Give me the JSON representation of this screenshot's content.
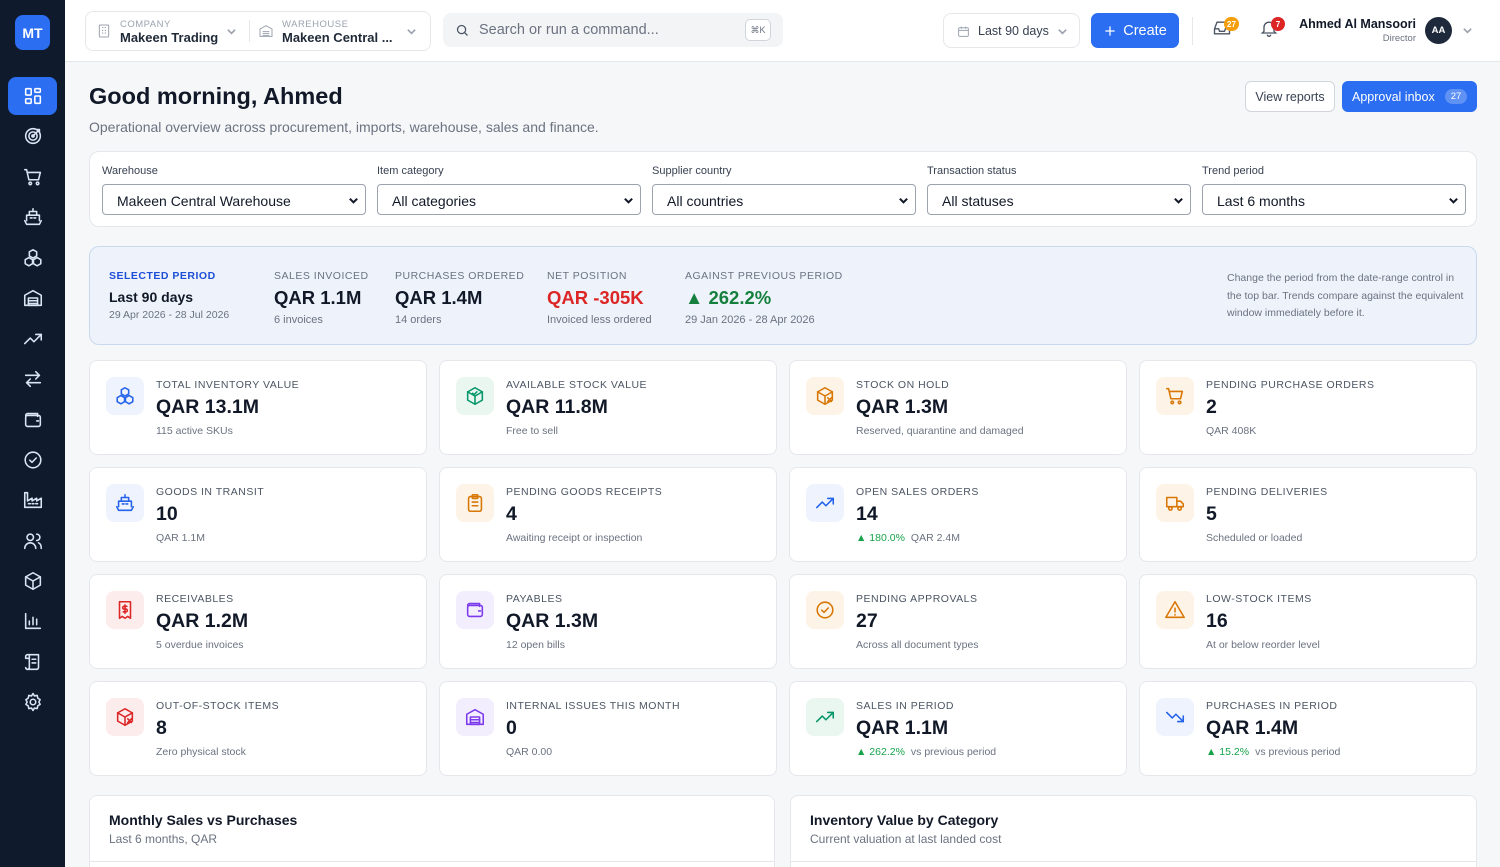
{
  "sidebar": {
    "logo": "MT",
    "items": [
      {
        "icon": "dashboard-icon",
        "active": true
      },
      {
        "icon": "target-icon"
      },
      {
        "icon": "cart-icon"
      },
      {
        "icon": "ship-icon"
      },
      {
        "icon": "boxes-icon"
      },
      {
        "icon": "warehouse-icon"
      },
      {
        "icon": "trending-up-icon"
      },
      {
        "icon": "transfer-icon"
      },
      {
        "icon": "wallet-icon"
      },
      {
        "icon": "check-circle-icon"
      },
      {
        "icon": "factory-icon"
      },
      {
        "icon": "users-icon"
      },
      {
        "icon": "package-icon"
      },
      {
        "icon": "bar-chart-icon"
      },
      {
        "icon": "scroll-icon"
      },
      {
        "icon": "settings-icon"
      }
    ]
  },
  "topbar": {
    "company_label": "COMPANY",
    "company_value": "Makeen Trading",
    "warehouse_label": "WAREHOUSE",
    "warehouse_value": "Makeen Central ...",
    "search_placeholder": "Search or run a command...",
    "search_shortcut": "⌘K",
    "date_range": "Last 90 days",
    "create_label": "Create",
    "inbox_badge": "27",
    "notif_badge": "7",
    "user_name": "Ahmed Al Mansoori",
    "user_role": "Director",
    "user_initials": "AA"
  },
  "header": {
    "greeting": "Good morning, Ahmed",
    "subtitle": "Operational overview across procurement, imports, warehouse, sales and finance.",
    "view_reports": "View reports",
    "approval_inbox": "Approval inbox",
    "approval_count": "27"
  },
  "filters": [
    {
      "label": "Warehouse",
      "value": "Makeen Central Warehouse"
    },
    {
      "label": "Item category",
      "value": "All categories"
    },
    {
      "label": "Supplier country",
      "value": "All countries"
    },
    {
      "label": "Transaction status",
      "value": "All statuses"
    },
    {
      "label": "Trend period",
      "value": "Last 6 months"
    }
  ],
  "period": {
    "selected_label": "SELECTED PERIOD",
    "selected_value": "Last 90 days",
    "selected_range": "29 Apr 2026 - 28 Jul 2026",
    "sales_label": "SALES INVOICED",
    "sales_value": "QAR 1.1M",
    "sales_sub": "6 invoices",
    "purchases_label": "PURCHASES ORDERED",
    "purchases_value": "QAR 1.4M",
    "purchases_sub": "14 orders",
    "net_label": "NET POSITION",
    "net_value": "QAR -305K",
    "net_sub": "Invoiced less ordered",
    "against_label": "AGAINST PREVIOUS PERIOD",
    "against_value": "▲ 262.2%",
    "against_sub": "29 Jan 2026 - 28 Apr 2026",
    "note": "Change the period from the date-range control in the top bar. Trends compare against the equivalent window immediately before it."
  },
  "cards": [
    {
      "label": "TOTAL INVENTORY VALUE",
      "value": "QAR 13.1M",
      "sub": "115 active SKUs",
      "icon": "boxes-icon",
      "color": "#2563eb",
      "bg": "#eef3fd"
    },
    {
      "label": "AVAILABLE STOCK VALUE",
      "value": "QAR 11.8M",
      "sub": "Free to sell",
      "icon": "box-check-icon",
      "color": "#059669",
      "bg": "#eaf7f1"
    },
    {
      "label": "STOCK ON HOLD",
      "value": "QAR 1.3M",
      "sub": "Reserved, quarantine and damaged",
      "icon": "box-x-icon",
      "color": "#d97706",
      "bg": "#fdf3e6"
    },
    {
      "label": "PENDING PURCHASE ORDERS",
      "value": "2",
      "sub": "QAR 408K",
      "icon": "cart-icon",
      "color": "#d97706",
      "bg": "#fdf3e6"
    },
    {
      "label": "GOODS IN TRANSIT",
      "value": "10",
      "sub": "QAR 1.1M",
      "icon": "ship-icon",
      "color": "#2563eb",
      "bg": "#eef3fd"
    },
    {
      "label": "PENDING GOODS RECEIPTS",
      "value": "4",
      "sub": "Awaiting receipt or inspection",
      "icon": "clipboard-icon",
      "color": "#d97706",
      "bg": "#fdf3e6"
    },
    {
      "label": "OPEN SALES ORDERS",
      "value": "14",
      "sub_up": "▲ 180.0%",
      "sub": "QAR 2.4M",
      "icon": "trending-up-icon",
      "color": "#2563eb",
      "bg": "#eef3fd"
    },
    {
      "label": "PENDING DELIVERIES",
      "value": "5",
      "sub": "Scheduled or loaded",
      "icon": "truck-icon",
      "color": "#d97706",
      "bg": "#fdf3e6"
    },
    {
      "label": "RECEIVABLES",
      "value": "QAR 1.2M",
      "sub": "5 overdue invoices",
      "icon": "invoice-dollar-icon",
      "color": "#dc2626",
      "bg": "#fdecec"
    },
    {
      "label": "PAYABLES",
      "value": "QAR 1.3M",
      "sub": "12 open bills",
      "icon": "wallet-icon",
      "color": "#7c3aed",
      "bg": "#f3eefe"
    },
    {
      "label": "PENDING APPROVALS",
      "value": "27",
      "sub": "Across all document types",
      "icon": "check-circle-icon",
      "color": "#d97706",
      "bg": "#fdf3e6"
    },
    {
      "label": "LOW-STOCK ITEMS",
      "value": "16",
      "sub": "At or below reorder level",
      "icon": "warning-icon",
      "color": "#d97706",
      "bg": "#fdf3e6"
    },
    {
      "label": "OUT-OF-STOCK ITEMS",
      "value": "8",
      "sub": "Zero physical stock",
      "icon": "box-x-icon",
      "color": "#dc2626",
      "bg": "#fdecec"
    },
    {
      "label": "INTERNAL ISSUES THIS MONTH",
      "value": "0",
      "sub": "QAR 0.00",
      "icon": "warehouse-icon",
      "color": "#7c3aed",
      "bg": "#f3eefe"
    },
    {
      "label": "SALES IN PERIOD",
      "value": "QAR 1.1M",
      "sub_up": "▲ 262.2%",
      "sub": "vs previous period",
      "icon": "trending-up-icon",
      "color": "#059669",
      "bg": "#eaf7f1"
    },
    {
      "label": "PURCHASES IN PERIOD",
      "value": "QAR 1.4M",
      "sub_up": "▲ 15.2%",
      "sub": "vs previous period",
      "icon": "trending-down-icon",
      "color": "#2563eb",
      "bg": "#eef3fd"
    }
  ],
  "panels": [
    {
      "title": "Monthly Sales vs Purchases",
      "subtitle": "Last 6 months, QAR"
    },
    {
      "title": "Inventory Value by Category",
      "subtitle": "Current valuation at last landed cost"
    }
  ]
}
